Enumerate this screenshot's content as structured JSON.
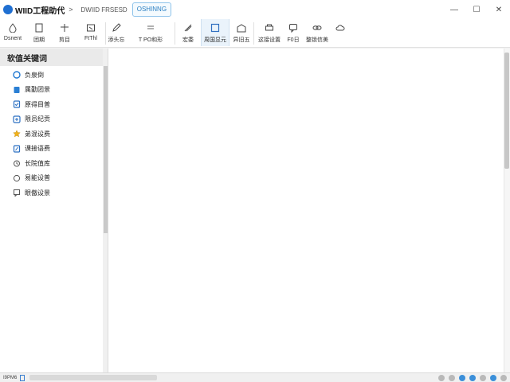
{
  "title_bar": {
    "app_name": "WIID工程助代",
    "crumb_separator": ">",
    "doc_name": "DWIID FRSESD",
    "tab_label": "OSHINNG",
    "window_buttons": {
      "minimize": "—",
      "maximize": "☐",
      "close": "✕"
    }
  },
  "toolbar": {
    "tools": [
      {
        "id": "select",
        "label": "Dsnent",
        "icon": "drop-icon"
      },
      {
        "id": "open",
        "label": "团期",
        "icon": "page-icon"
      },
      {
        "id": "cut",
        "label": "剪目",
        "icon": "cross-tool-icon"
      },
      {
        "id": "print",
        "label": "FtThl",
        "icon": "frame-icon"
      },
      {
        "id": "insert",
        "label": "添头忘",
        "icon": "edit-box-icon"
      },
      {
        "id": "line",
        "label": "T PO和形",
        "icon": "line-icon"
      },
      {
        "id": "pen",
        "label": "宏委",
        "icon": "pen-icon"
      },
      {
        "id": "display",
        "label": "周国显元",
        "icon": "square-icon",
        "active": true
      },
      {
        "id": "layer",
        "label": "异旧五",
        "icon": "building-icon"
      },
      {
        "id": "settings",
        "label": "这接设置",
        "icon": "print-icon"
      },
      {
        "id": "bubble",
        "label": "F0日",
        "icon": "bubble-icon"
      },
      {
        "id": "link",
        "label": "整锁信美",
        "icon": "link-icon"
      },
      {
        "id": "cloud",
        "label": "",
        "icon": "cloud-icon"
      }
    ]
  },
  "sidebar": {
    "header": "软值关键词",
    "items": [
      {
        "label": "负泉倒",
        "icon": "e-icon"
      },
      {
        "label": "属勤团景",
        "icon": "doc-icon"
      },
      {
        "label": "原得目普",
        "icon": "check-icon"
      },
      {
        "label": "限员纪贡",
        "icon": "plus-icon"
      },
      {
        "label": "弟混设费",
        "icon": "star-icon"
      },
      {
        "label": "课接语费",
        "icon": "leaf-icon"
      },
      {
        "label": "长院值库",
        "icon": "clock-icon"
      },
      {
        "label": "易能设普",
        "icon": "circle-icon"
      },
      {
        "label": "眼傲设景",
        "icon": "chat-icon"
      }
    ]
  },
  "status_bar": {
    "text": "I9PM6"
  }
}
